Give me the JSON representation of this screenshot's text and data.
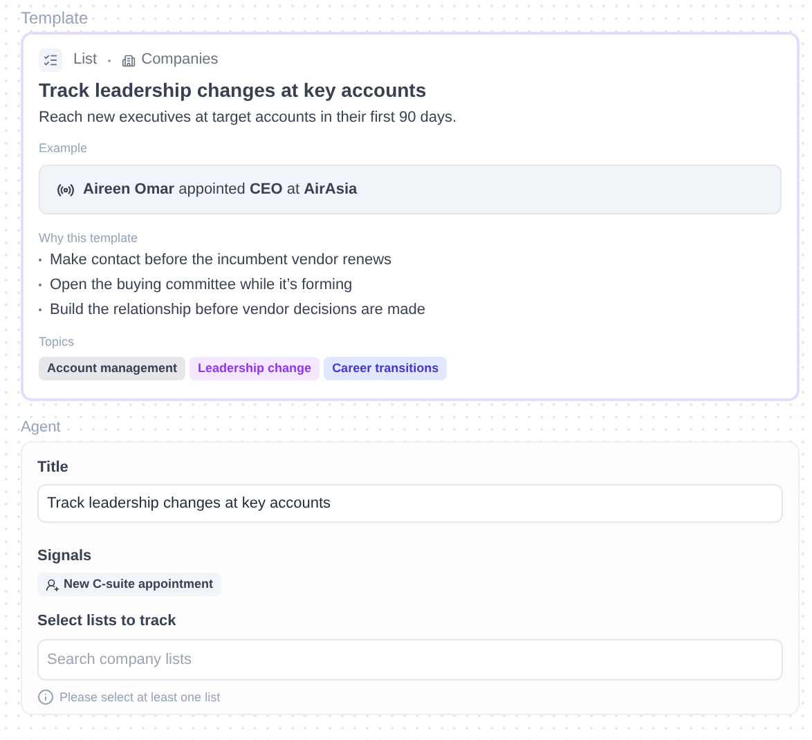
{
  "template": {
    "label": "Template",
    "breadcrumb": {
      "type": "List",
      "entity": "Companies"
    },
    "title": "Track leadership changes at key accounts",
    "description": "Reach new executives at target accounts in their first 90 days.",
    "example": {
      "label": "Example",
      "text": "**Aireen Omar** appointed **CEO** at **AirAsia**"
    },
    "why": {
      "label": "Why this template",
      "items": [
        "Make contact before the incumbent vendor renews",
        "Open the buying committee while it’s forming",
        "Build the relationship before vendor decisions are made"
      ]
    },
    "topics": {
      "label": "Topics",
      "items": [
        {
          "label": "Account management",
          "color": "#374151"
        },
        {
          "label": "Leadership change",
          "color": "#9333ea"
        },
        {
          "label": "Career transitions",
          "color": "#4338ca"
        }
      ]
    }
  },
  "agent": {
    "label": "Agent",
    "title_field": {
      "label": "Title",
      "value": "Track leadership changes at key accounts"
    },
    "signals": {
      "label": "Signals",
      "items": [
        "New C-suite appointment"
      ]
    },
    "lists": {
      "label": "Select lists to track",
      "placeholder": "Search company lists",
      "hint": "Please select at least one list"
    }
  }
}
